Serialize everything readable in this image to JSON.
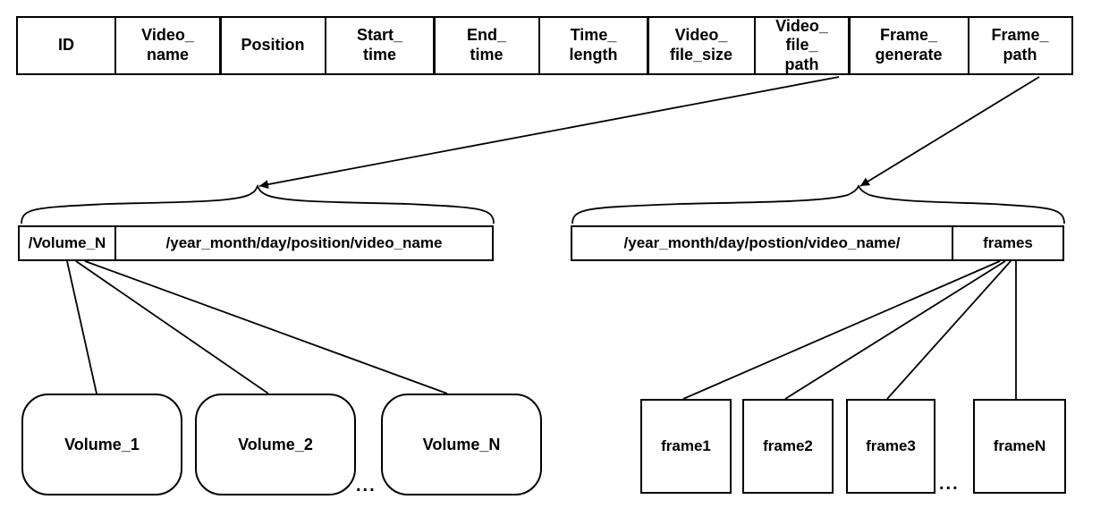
{
  "header": [
    "ID",
    "Video_\nname",
    "Position",
    "Start_\ntime",
    "End_\ntime",
    "Time_\nlength",
    "Video_\nfile_size",
    "Video_\nfile_\npath",
    "Frame_\ngenerate",
    "Frame_\npath"
  ],
  "sub_left": {
    "a": "/Volume_N",
    "b": "/year_month/day/position/video_name"
  },
  "sub_right": {
    "a": "/year_month/day/postion/video_name/",
    "b": "frames"
  },
  "volumes": [
    "Volume_1",
    "Volume_2",
    "Volume_N"
  ],
  "frames": [
    "frame1",
    "frame2",
    "frame3",
    "frameN"
  ],
  "ellipsis": "..."
}
